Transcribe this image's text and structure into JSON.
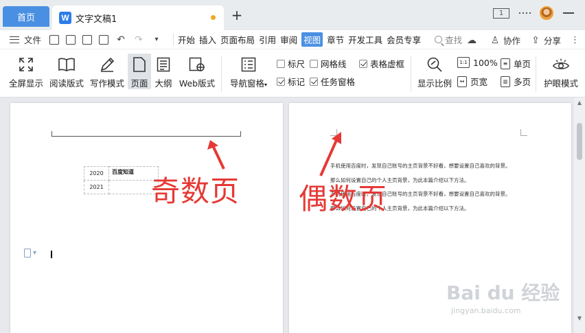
{
  "tabs": {
    "home": "首页",
    "doc_logo": "W",
    "doc_title": "文字文稿1",
    "add": "+"
  },
  "window": {
    "layout_badge": "1"
  },
  "menubar": {
    "file": "文件",
    "items": [
      "开始",
      "插入",
      "页面布局",
      "引用",
      "审阅",
      "视图",
      "章节",
      "开发工具",
      "会员专享"
    ],
    "active_index": 5,
    "search": "查找",
    "collab": "协作",
    "share": "分享"
  },
  "ribbon": {
    "fullscreen": "全屏显示",
    "reading": "阅读版式",
    "writing": "写作模式",
    "page": "页面",
    "outline": "大纲",
    "web": "Web版式",
    "nav_pane": "导航窗格",
    "ruler": "标尺",
    "gridlines": "网格线",
    "table_gridlines": "表格虚框",
    "markup": "标记",
    "task_pane": "任务窗格",
    "zoom": "显示比例",
    "zoom_100": "100%",
    "single_page": "单页",
    "page_width": "页宽",
    "multi_page": "多页",
    "eye_protect": "护眼模式",
    "checks": {
      "ruler": false,
      "gridlines": false,
      "table_gridlines": true,
      "markup": true,
      "task_pane": true
    }
  },
  "document": {
    "table": [
      {
        "year": "2020",
        "value": "百度知道"
      },
      {
        "year": "2021",
        "value": ""
      }
    ],
    "paragraphs": [
      "手机使用百度时，发现自己账号的主页背景不好看，想要设置自己喜欢的背景。",
      "那么如何设置自己的个人主页背景，为此本篇介绍以下方法。",
      "手机使用百度时，发现自己账号的主页背景不好看，想要设置自己喜欢的背景。",
      "那么如何设置自己的个人主页背景，为此本篇介绍以下方法。"
    ],
    "odd_label": "奇数页",
    "even_label": "偶数页"
  },
  "watermark": {
    "brand": "Bai du 经验",
    "url": "jingyan.baidu.com"
  },
  "colors": {
    "accent": "#4a90e2",
    "annotation": "#e53935"
  }
}
